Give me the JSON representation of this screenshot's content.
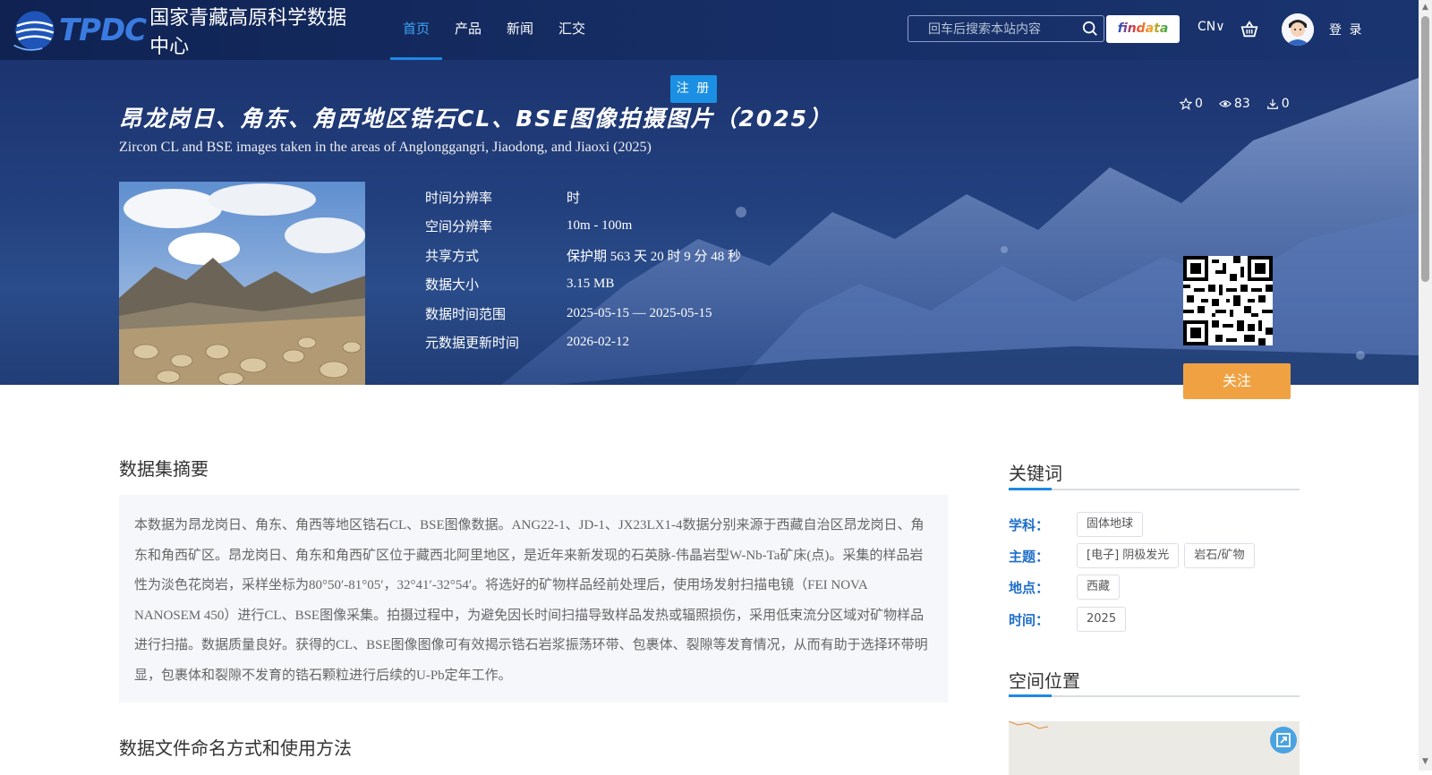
{
  "header": {
    "logo_text_en": "TPDC",
    "logo_text_cn": "国家青藏高原科学数据中心",
    "nav": [
      {
        "label": "首页",
        "active": true
      },
      {
        "label": "产品",
        "active": false
      },
      {
        "label": "新闻",
        "active": false
      },
      {
        "label": "汇交",
        "active": false
      }
    ],
    "search_placeholder": "回车后搜索本站内容",
    "findata_label": "findata",
    "language": "CN∨",
    "login_label": "登 录"
  },
  "hero": {
    "register_tag": "注 册",
    "title_cn": "昂龙岗日、角东、角西地区锆石CL、BSE图像拍摄图片（2025）",
    "title_en": "Zircon CL and BSE images taken in the areas of Anglonggangri, Jiaodong, and Jiaoxi (2025)",
    "stats": {
      "stars": "0",
      "views": "83",
      "downloads": "0"
    },
    "metadata": [
      {
        "label": "时间分辨率",
        "value": "时"
      },
      {
        "label": "空间分辨率",
        "value": "10m - 100m"
      },
      {
        "label": "共享方式",
        "value": "保护期 563 天 20 时 9 分 48 秒"
      },
      {
        "label": "数据大小",
        "value": "3.15 MB"
      },
      {
        "label": "数据时间范围",
        "value": "2025-05-15 — 2025-05-15"
      },
      {
        "label": "元数据更新时间",
        "value": "2026-02-12"
      }
    ],
    "follow_label": "关注"
  },
  "main": {
    "abstract_heading": "数据集摘要",
    "abstract_text": "本数据为昂龙岗日、角东、角西等地区锆石CL、BSE图像数据。ANG22-1、JD-1、JX23LX1-4数据分别来源于西藏自治区昂龙岗日、角东和角西矿区。昂龙岗日、角东和角西矿区位于藏西北阿里地区，是近年来新发现的石英脉-伟晶岩型W-Nb-Ta矿床(点)。采集的样品岩性为淡色花岗岩，采样坐标为80°50′-81°05′，32°41′-32°54′。将选好的矿物样品经前处理后，使用场发射扫描电镜（FEI NOVA NANOSEM 450）进行CL、BSE图像采集。拍摄过程中，为避免因长时间扫描导致样品发热或辐照损伤，采用低束流分区域对矿物样品进行扫描。数据质量良好。获得的CL、BSE图像图像可有效揭示锆石岩浆振荡环带、包裹体、裂隙等发育情况，从而有助于选择环带明显，包裹体和裂隙不发育的锆石颗粒进行后续的U-Pb定年工作。",
    "naming_heading": "数据文件命名方式和使用方法"
  },
  "sidebar": {
    "keywords_heading": "关键词",
    "keywords": [
      {
        "label": "学科：",
        "tags": [
          "固体地球"
        ]
      },
      {
        "label": "主题：",
        "tags": [
          "[电子] 阴极发光",
          "岩石/矿物"
        ]
      },
      {
        "label": "地点：",
        "tags": [
          "西藏"
        ]
      },
      {
        "label": "时间：",
        "tags": [
          "2025"
        ]
      }
    ],
    "location_heading": "空间位置"
  },
  "colors": {
    "header_bg": "#152c62",
    "accent_blue": "#1e88e5",
    "follow_orange": "#f0a243",
    "keyword_label": "#1e6ec8"
  }
}
